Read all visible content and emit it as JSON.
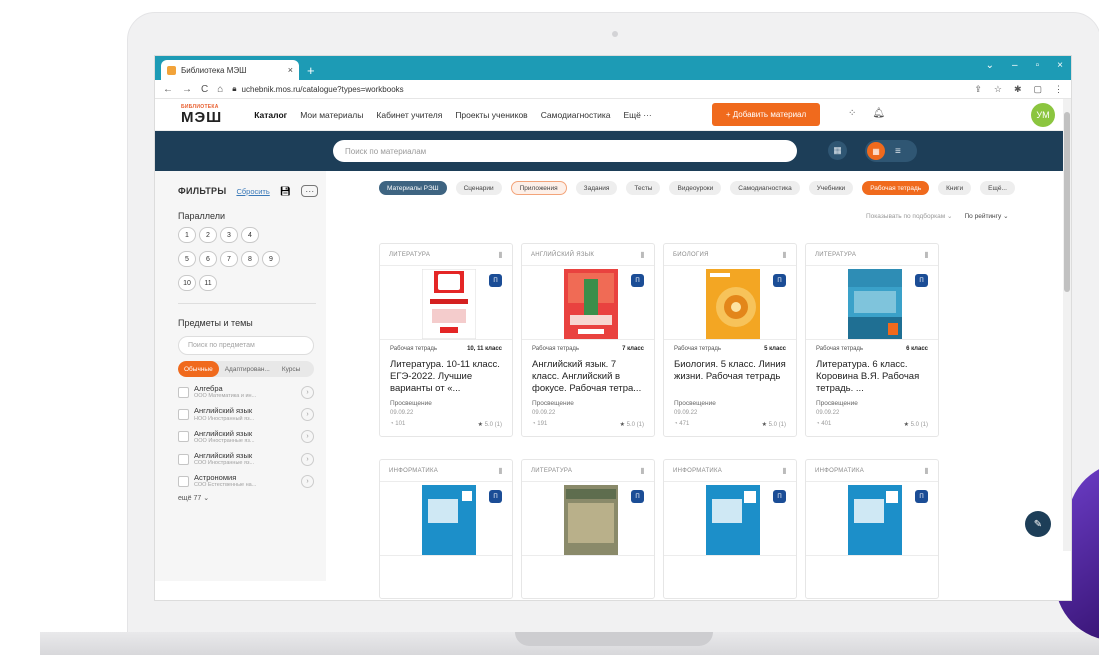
{
  "browser": {
    "tab_title": "Библиотека МЭШ",
    "tab_close": "×",
    "new_tab": "+",
    "url": "uchebnik.mos.ru/catalogue?types=workbooks",
    "window_controls": [
      "⌄",
      "–",
      "▫",
      "×"
    ]
  },
  "header": {
    "logo_small": "БИБЛИОТЕКА",
    "logo_big": "МЭШ",
    "nav": [
      "Каталог",
      "Мои материалы",
      "Кабинет учителя",
      "Проекты учеников",
      "Самодиагностика",
      "Ещё ···"
    ],
    "add_button": "+ Добавить материал",
    "avatar_initials": "УМ"
  },
  "search": {
    "placeholder": "Поиск по материалам"
  },
  "filters": {
    "title": "ФИЛЬТРЫ",
    "reset": "Сбросить",
    "parallels_title": "Параллели",
    "grades": [
      "1",
      "2",
      "3",
      "4",
      "5",
      "6",
      "7",
      "8",
      "9",
      "10",
      "11"
    ],
    "subjects_title": "Предметы и темы",
    "subject_search_placeholder": "Поиск по предметам",
    "segments": [
      "Обычные",
      "Адаптирован...",
      "Курсы"
    ],
    "subjects": [
      {
        "name": "Алгебра",
        "sub": "ООО Математика и ин..."
      },
      {
        "name": "Английский язык",
        "sub": "НОО Иностранный яз..."
      },
      {
        "name": "Английский язык",
        "sub": "ООО Иностранные яз..."
      },
      {
        "name": "Английский язык",
        "sub": "СОО Иностранные яз..."
      },
      {
        "name": "Астрономия",
        "sub": "СОО Естественные на..."
      }
    ],
    "more": "ещё 77 ⌄"
  },
  "chips": [
    "Материалы РЭШ",
    "Сценарии",
    "Приложения",
    "Задания",
    "Тесты",
    "Видеоуроки",
    "Самодиагностика",
    "Учебники",
    "Рабочая тетрадь",
    "Книги",
    "Ещё..."
  ],
  "sort": {
    "left": "Показывать по подборкам ⌄",
    "right": "По рейтингу ⌄"
  },
  "cards": [
    {
      "subject": "ЛИТЕРАТУРА",
      "type": "Рабочая тетрадь",
      "grade": "10, 11 класс",
      "title": "Литература. 10-11 класс. ЕГЭ-2022. Лучшие варианты от «...",
      "publisher": "Просвещение",
      "date": "09.09.22",
      "views": "101",
      "rating": "5.0 (1)"
    },
    {
      "subject": "АНГЛИЙСКИЙ ЯЗЫК",
      "type": "Рабочая тетрадь",
      "grade": "7 класс",
      "title": "Английский язык. 7 класс. Английский в фокусе. Рабочая тетра...",
      "publisher": "Просвещение",
      "date": "09.09.22",
      "views": "191",
      "rating": "5.0 (1)"
    },
    {
      "subject": "БИОЛОГИЯ",
      "type": "Рабочая тетрадь",
      "grade": "5 класс",
      "title": "Биология. 5 класс. Линия жизни. Рабочая тетрадь",
      "publisher": "Просвещение",
      "date": "09.09.22",
      "views": "471",
      "rating": "5.0 (1)"
    },
    {
      "subject": "ЛИТЕРАТУРА",
      "type": "Рабочая тетрадь",
      "grade": "6 класс",
      "title": "Литература. 6 класс. Коровина В.Я. Рабочая тетрадь. ...",
      "publisher": "Просвещение",
      "date": "09.09.22",
      "views": "401",
      "rating": "5.0 (1)"
    },
    {
      "subject": "ИНФОРМАТИКА"
    },
    {
      "subject": "ЛИТЕРАТУРА"
    },
    {
      "subject": "ИНФОРМАТИКА"
    },
    {
      "subject": "ИНФОРМАТИКА"
    }
  ],
  "colors": {
    "accent": "#f06a1d",
    "brand_dark": "#1d3e58",
    "tabbar": "#1d9bb5"
  }
}
